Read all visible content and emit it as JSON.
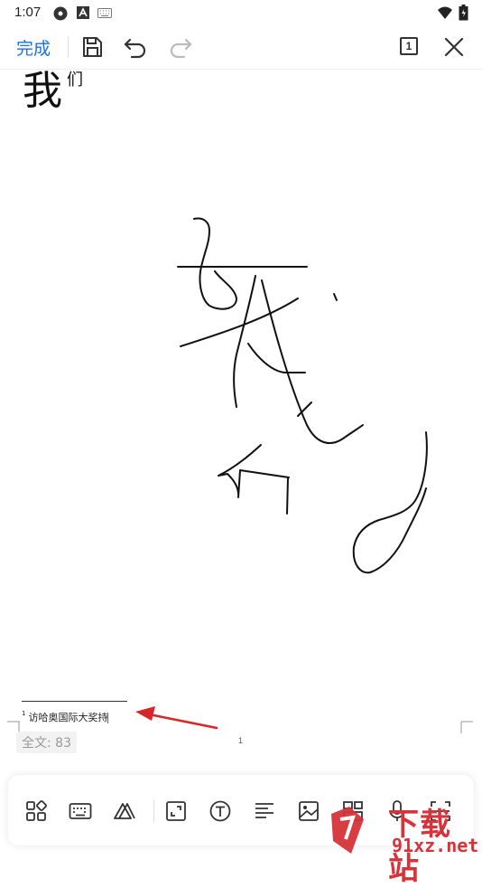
{
  "status_bar": {
    "time": "1:07",
    "icons": [
      "settings-icon",
      "a-icon",
      "keyboard-icon",
      "wifi-icon",
      "battery-icon"
    ]
  },
  "toolbar": {
    "done_label": "完成",
    "page_count": "1",
    "icons": [
      "save-icon",
      "undo-icon",
      "redo-icon",
      "page-view-icon",
      "close-icon"
    ],
    "accent_color": "#1a73e8"
  },
  "document": {
    "title_large": "我",
    "title_small": "们",
    "footnote_marker": "1",
    "footnote_text": "访哈奥国际大奖持",
    "page_number": "1",
    "word_count": "全文: 83"
  },
  "bottom_toolbar": {
    "icons": [
      "apps-icon",
      "keyboard-icon",
      "handwriting-icon",
      "fullscreen-icon",
      "text-icon",
      "align-icon",
      "image-icon",
      "layout-icon",
      "voice-icon",
      "scan-icon"
    ]
  },
  "watermark": {
    "text_top": "下载站",
    "text_bottom": "91xz.net",
    "color": "#d6333a"
  }
}
